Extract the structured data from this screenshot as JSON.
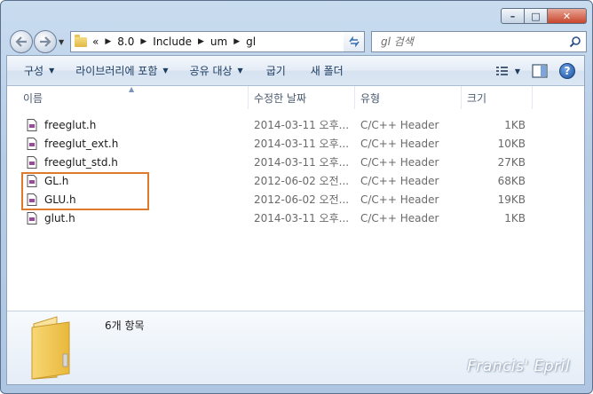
{
  "window": {
    "caption": {
      "minimize": "–",
      "maximize": "□",
      "close": "✕"
    }
  },
  "nav": {
    "back_icon": "back-arrow-icon",
    "forward_icon": "forward-arrow-icon"
  },
  "address": {
    "chevron": "«",
    "crumbs": [
      "8.0",
      "Include",
      "um",
      "gl"
    ]
  },
  "search": {
    "placeholder": "gl 검색"
  },
  "toolbar": {
    "organize": "구성",
    "add_to_library": "라이브러리에 포함",
    "share_with": "공유 대상",
    "burn": "굽기",
    "new_folder": "새 폴더"
  },
  "columns": {
    "name": "이름",
    "date_modified": "수정한 날짜",
    "type": "유형",
    "size": "크기"
  },
  "files": [
    {
      "name": "freeglut.h",
      "date": "2014-03-11 오후...",
      "type": "C/C++ Header",
      "size": "1KB"
    },
    {
      "name": "freeglut_ext.h",
      "date": "2014-03-11 오후...",
      "type": "C/C++ Header",
      "size": "10KB"
    },
    {
      "name": "freeglut_std.h",
      "date": "2014-03-11 오후...",
      "type": "C/C++ Header",
      "size": "27KB"
    },
    {
      "name": "GL.h",
      "date": "2012-06-02 오전...",
      "type": "C/C++ Header",
      "size": "68KB"
    },
    {
      "name": "GLU.h",
      "date": "2012-06-02 오전...",
      "type": "C/C++ Header",
      "size": "19KB"
    },
    {
      "name": "glut.h",
      "date": "2014-03-11 오후...",
      "type": "C/C++ Header",
      "size": "1KB"
    }
  ],
  "details": {
    "item_count": "6개 항목"
  },
  "watermark": "Francis' Epril",
  "colors": {
    "highlight_box": "#e07a2a",
    "toolbar_text": "#1e3d61"
  }
}
